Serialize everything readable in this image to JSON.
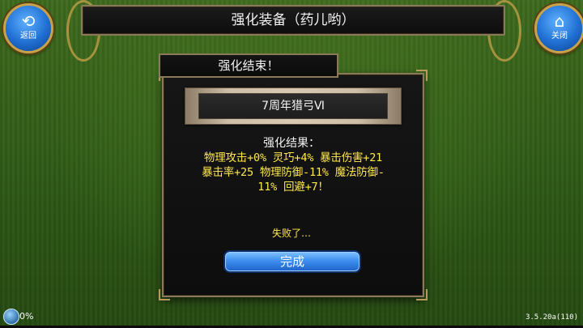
{
  "header": {
    "title": "强化装备（药儿哟）",
    "back_label": "返回",
    "close_label": "关闭",
    "back_icon": "back-arrow-icon",
    "close_icon": "home-icon"
  },
  "dialog": {
    "title": "强化结束！",
    "item_name": "7周年猎弓Ⅵ",
    "result_label": "强化结果：",
    "result_lines": [
      "物理攻击+0% 灵巧+4% 暴击伤害+21",
      "暴击率+25 物理防御-11% 魔法防御-",
      "11% 回避+7！"
    ],
    "fail_message": "失败了…",
    "done_button": "完成"
  },
  "footer": {
    "progress_text": "0%",
    "version": "3.5.20a(110)"
  },
  "colors": {
    "accent_blue": "#3f8ff0",
    "result_yellow": "#ffe94a",
    "frame_gold": "#8b7a5a"
  }
}
